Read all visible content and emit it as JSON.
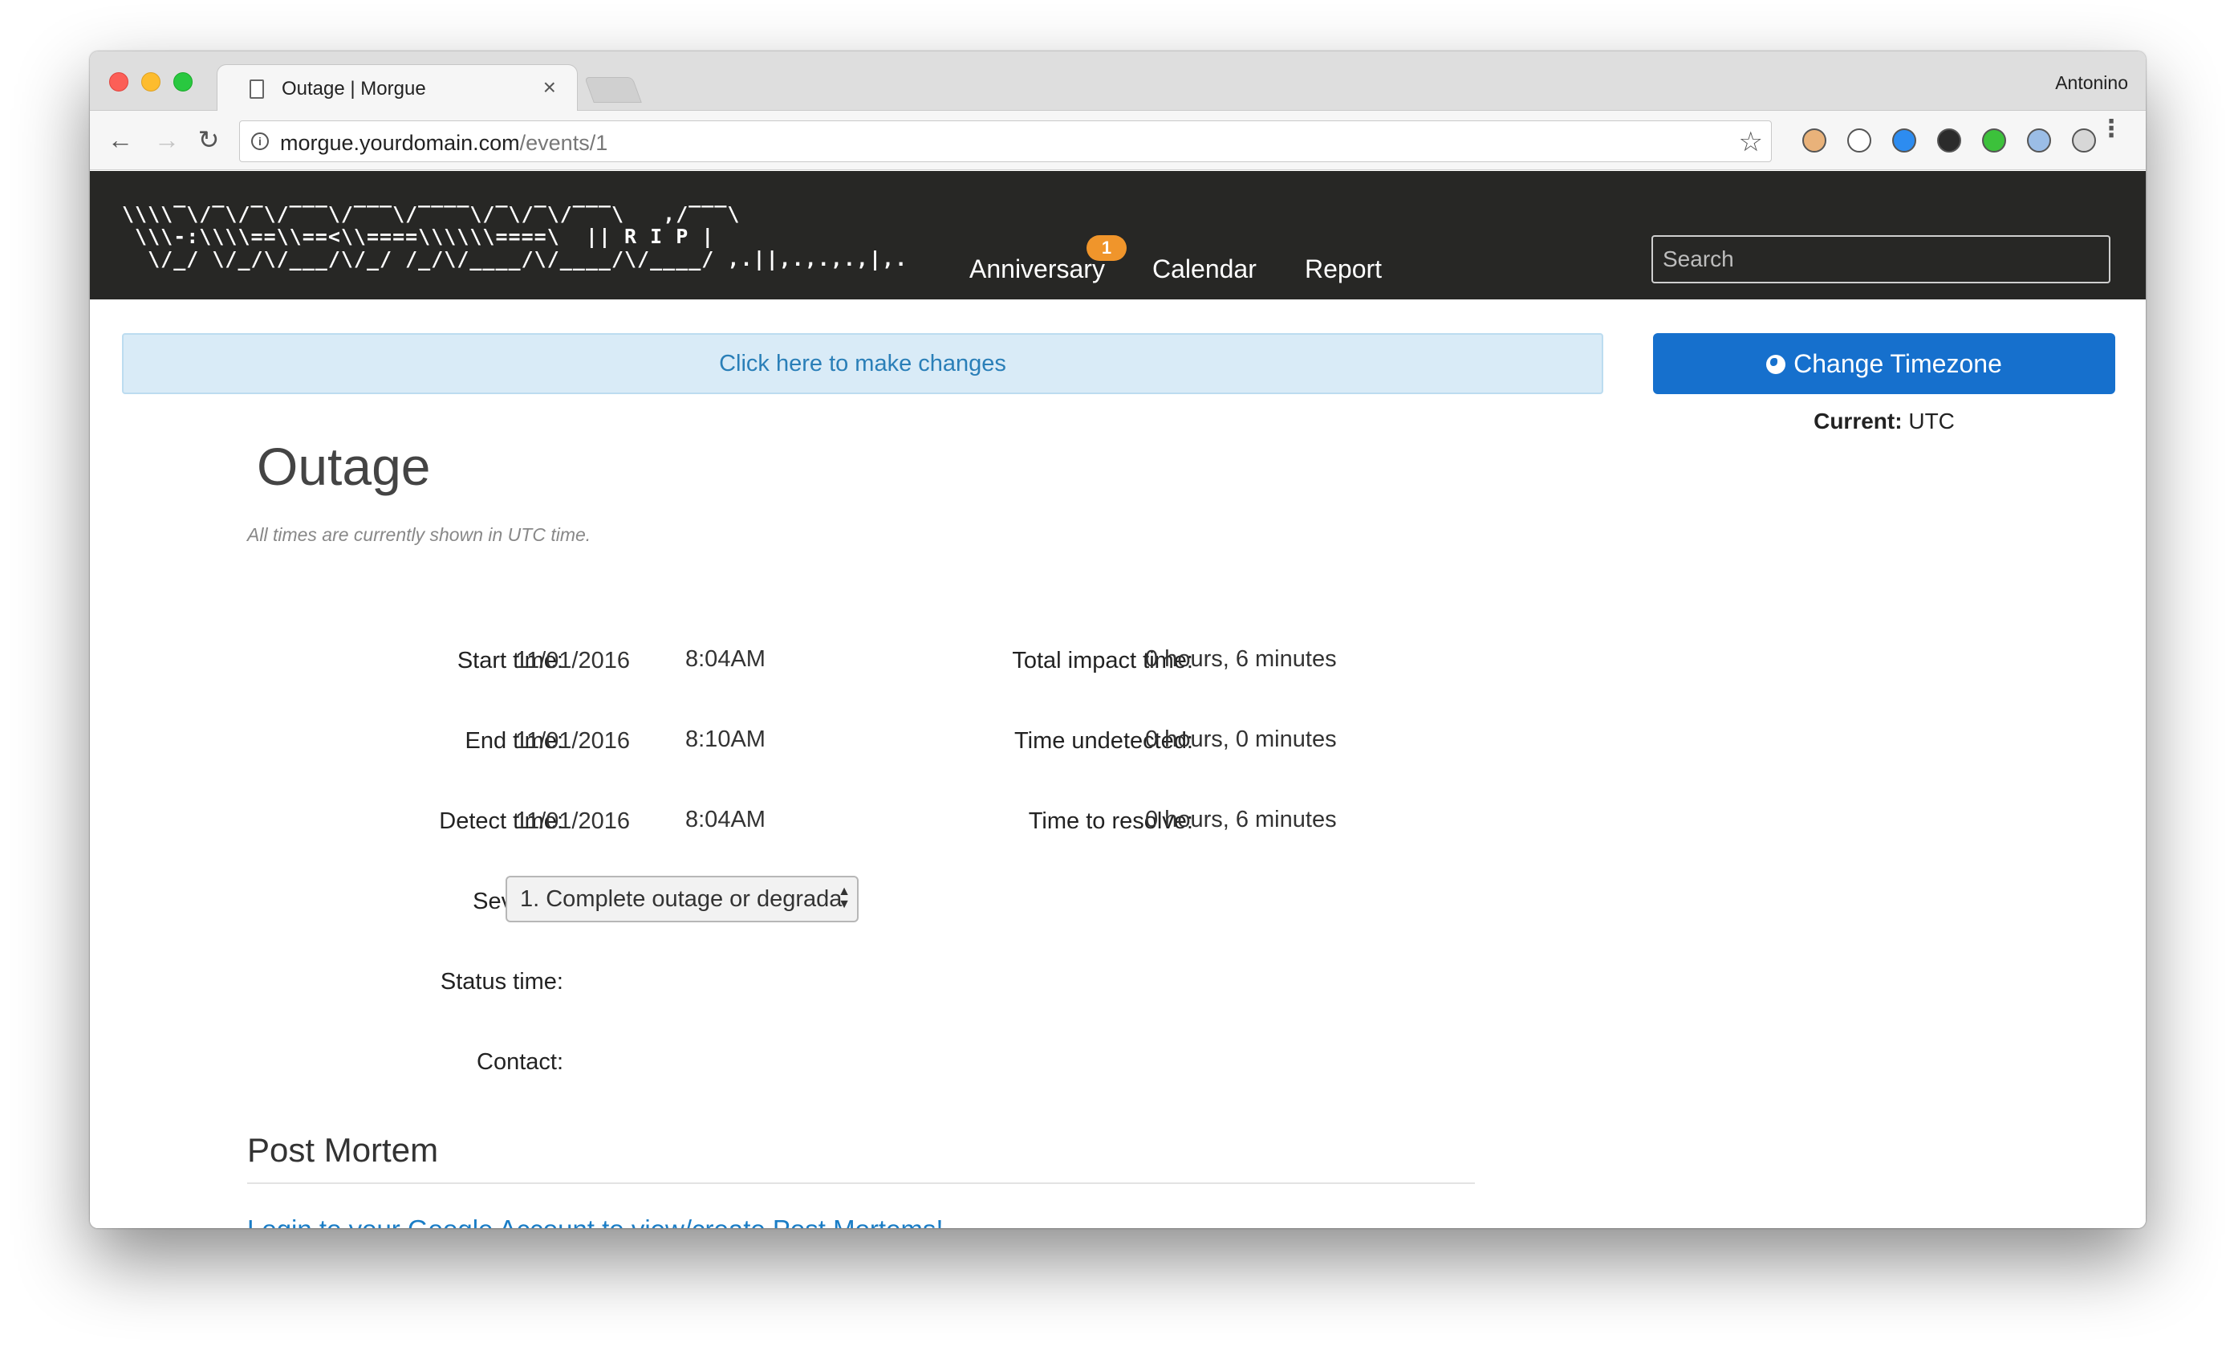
{
  "browser": {
    "tab_title": "Outage | Morgue",
    "tab_close": "×",
    "profile_name": "Antonino",
    "url_host": "morgue.yourdomain.com",
    "url_path": "/events/1",
    "info_icon": "i",
    "back_icon": "←",
    "forward_icon": "→",
    "reload_icon": "↻",
    "bookmark_icon": "☆",
    "menu_icon": "⋮",
    "extensions": [
      {
        "name": "ext-face-icon",
        "color": "#e9b27a"
      },
      {
        "name": "ext-block-icon",
        "color": "#ffffff"
      },
      {
        "name": "ext-camera-icon",
        "color": "#2d8cf0"
      },
      {
        "name": "ext-lens-icon",
        "color": "#2b2b2b"
      },
      {
        "name": "ext-recycle-icon",
        "color": "#3cc13b"
      },
      {
        "name": "ext-flag-icon",
        "color": "#9bbde6"
      },
      {
        "name": "ext-grid-icon",
        "color": "#d7d7d7"
      }
    ]
  },
  "navbar": {
    "logo_art": "\\\\\\\\‾\\/‾\\/‾\\/‾‾‾\\/‾‾‾\\/‾‾‾‾\\/‾\\/‾\\/‾‾‾\\   ,/‾‾‾\\\n \\\\\\-:\\\\\\\\==\\\\==<\\\\====\\\\\\\\\\\\====\\  || R I P |\n  \\/_/ \\/_/\\/___/\\/_/ /_/\\/____/\\/____/\\/____/ ,.||,.,.,.,|,.",
    "links": [
      "Anniversary",
      "Calendar",
      "Report"
    ],
    "anniversary_badge": "1",
    "search_placeholder": "Search"
  },
  "banner": {
    "edit_text": "Click here to make changes"
  },
  "timezone": {
    "button_label": "Change Timezone",
    "current_label": "Current:",
    "current_value": "UTC"
  },
  "event": {
    "title": "Outage",
    "time_note": "All times are currently shown in UTC time.",
    "start_label": "Start time:",
    "start_date": "11/01/2016",
    "start_time": "8:04AM",
    "end_label": "End time:",
    "end_date": "11/01/2016",
    "end_time": "8:10AM",
    "detect_label": "Detect time:",
    "detect_date": "11/01/2016",
    "detect_time": "8:04AM",
    "impact_label": "Total impact time:",
    "impact_value": "0 hours, 6 minutes",
    "undetected_label": "Time undetected:",
    "undetected_value": "0 hours, 0 minutes",
    "resolve_label": "Time to resolve:",
    "resolve_value": "0 hours, 6 minutes",
    "severity_label": "Severity:",
    "severity_value": "1. Complete outage or degrada",
    "status_label": "Status time:",
    "contact_label": "Contact:"
  },
  "postmortem": {
    "heading": "Post Mortem",
    "login_link": "Login to your Google Account to view/create Post Mortems!"
  }
}
